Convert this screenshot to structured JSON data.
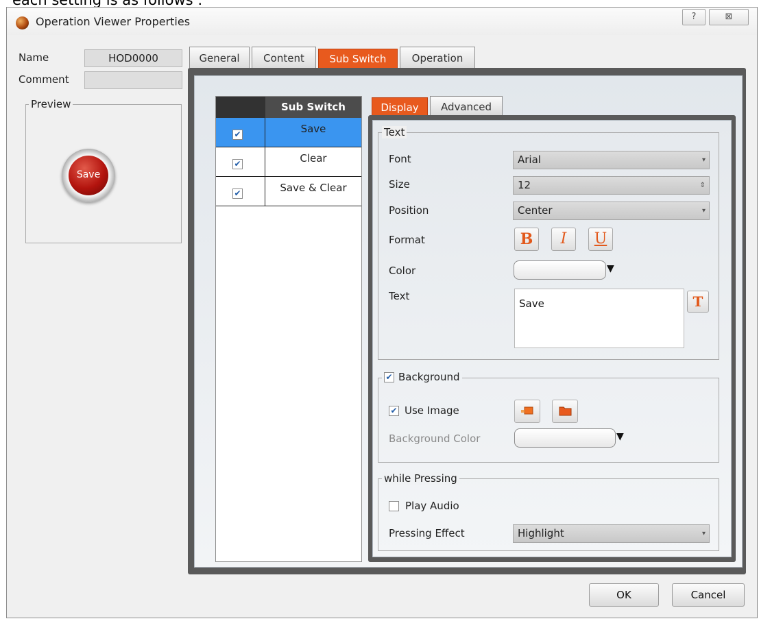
{
  "caption_fragment": "each setting is as follows :",
  "window": {
    "title": "Operation Viewer Properties",
    "help_glyph": "?",
    "close_glyph": "⊠"
  },
  "left": {
    "name_label": "Name",
    "name_value": "HOD0000",
    "comment_label": "Comment",
    "comment_value": "",
    "preview_label": "Preview",
    "preview_button_text": "Save"
  },
  "tabs": [
    "General",
    "Content",
    "Sub Switch",
    "Operation"
  ],
  "active_tab": "Sub Switch",
  "sub_switch": {
    "header": "Sub Switch",
    "rows": [
      {
        "label": "Save",
        "checked": true,
        "selected": true
      },
      {
        "label": "Clear",
        "checked": true,
        "selected": false
      },
      {
        "label": "Save & Clear",
        "checked": true,
        "selected": false
      }
    ]
  },
  "inner_tabs": [
    "Display",
    "Advanced"
  ],
  "active_inner_tab": "Display",
  "text_group": {
    "title": "Text",
    "font_label": "Font",
    "font_value": "Arial",
    "size_label": "Size",
    "size_value": "12",
    "position_label": "Position",
    "position_value": "Center",
    "format_label": "Format",
    "bold": "B",
    "italic": "I",
    "underline": "U",
    "color_label": "Color",
    "text_label": "Text",
    "text_value": "Save",
    "text_font_button": "T"
  },
  "background_group": {
    "title": "Background",
    "enabled": true,
    "use_image_label": "Use Image",
    "use_image": true,
    "bg_color_label": "Background Color"
  },
  "pressing_group": {
    "title": "while Pressing",
    "play_audio_label": "Play Audio",
    "play_audio": false,
    "effect_label": "Pressing Effect",
    "effect_value": "Highlight"
  },
  "buttons": {
    "ok": "OK",
    "cancel": "Cancel"
  },
  "colors": {
    "accent": "#e85a1e",
    "selection": "#3a95f0",
    "header_dark": "#4c4c4c"
  },
  "icons": [
    "app-icon",
    "help-icon",
    "close-icon",
    "checkbox-icon",
    "dropdown-arrow-icon",
    "spinner-icon",
    "image-insert-icon",
    "folder-open-icon",
    "text-font-icon"
  ]
}
